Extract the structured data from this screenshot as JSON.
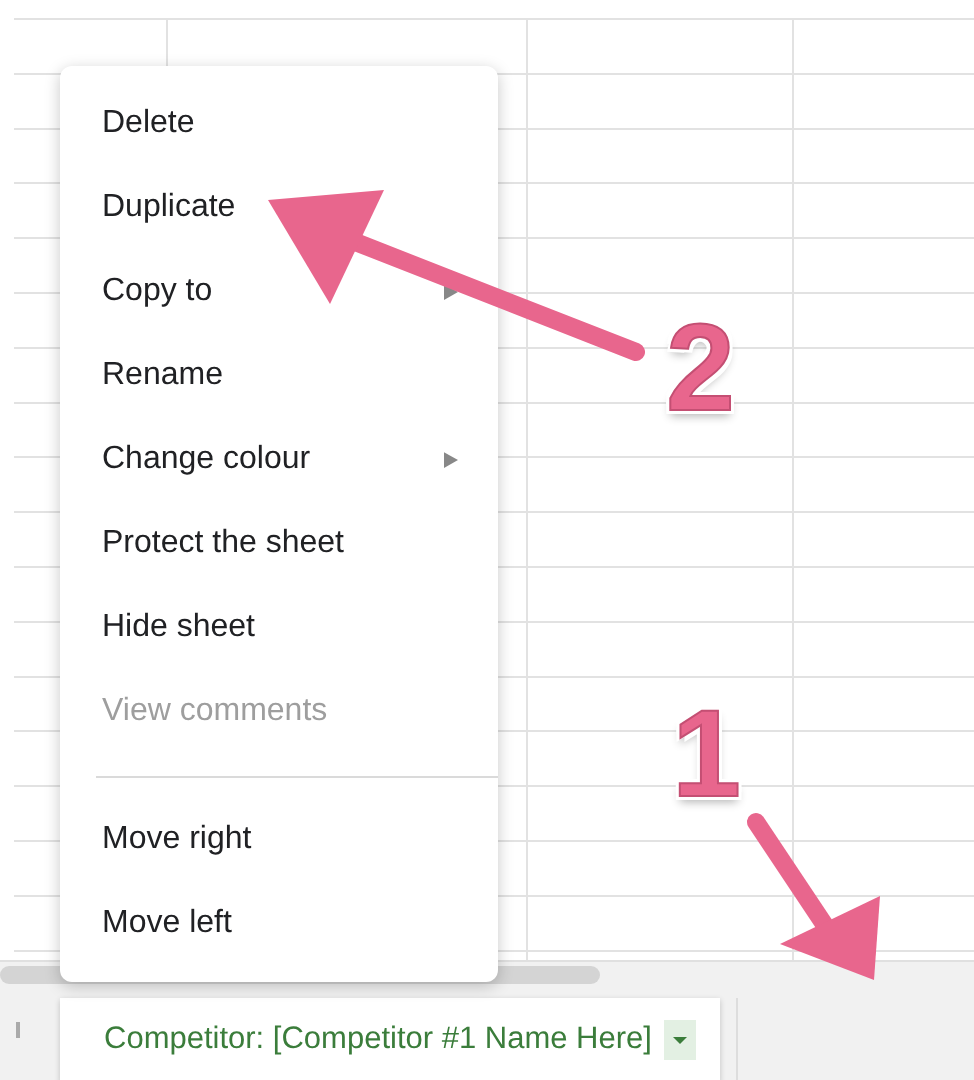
{
  "context_menu": {
    "items": [
      {
        "kind": "item",
        "label": "Delete",
        "disabled": false,
        "submenu": false
      },
      {
        "kind": "item",
        "label": "Duplicate",
        "disabled": false,
        "submenu": false
      },
      {
        "kind": "item",
        "label": "Copy to",
        "disabled": false,
        "submenu": true
      },
      {
        "kind": "item",
        "label": "Rename",
        "disabled": false,
        "submenu": false
      },
      {
        "kind": "item",
        "label": "Change colour",
        "disabled": false,
        "submenu": true
      },
      {
        "kind": "item",
        "label": "Protect the sheet",
        "disabled": false,
        "submenu": false
      },
      {
        "kind": "item",
        "label": "Hide sheet",
        "disabled": false,
        "submenu": false
      },
      {
        "kind": "item",
        "label": "View comments",
        "disabled": true,
        "submenu": false
      },
      {
        "kind": "separator"
      },
      {
        "kind": "item",
        "label": "Move right",
        "disabled": false,
        "submenu": false
      },
      {
        "kind": "item",
        "label": "Move left",
        "disabled": false,
        "submenu": false
      }
    ]
  },
  "sheet_tabs": [
    {
      "label": "Competitor: [Competitor #1 Name Here]",
      "selected": true
    }
  ],
  "annotations": [
    {
      "label": "2"
    },
    {
      "label": "1"
    }
  ]
}
